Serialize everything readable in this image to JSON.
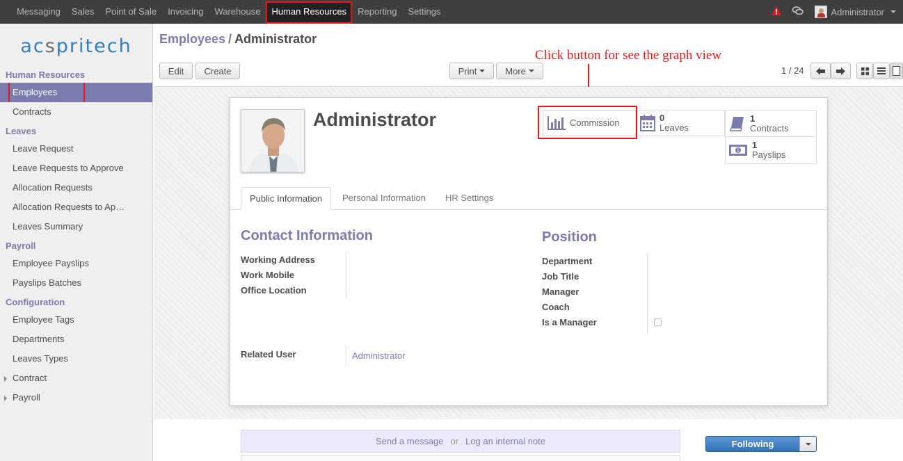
{
  "topbar": {
    "menu": [
      "Messaging",
      "Sales",
      "Point of Sale",
      "Invoicing",
      "Warehouse",
      "Human Resources",
      "Reporting",
      "Settings"
    ],
    "active_menu": "Human Resources",
    "user": "Administrator"
  },
  "sidebar": {
    "logo_left": "ac",
    "logo_mid": "s",
    "logo_right": "pritech",
    "sections": [
      {
        "title": "Human Resources",
        "items": [
          "Employees",
          "Contracts"
        ]
      },
      {
        "title": "Leaves",
        "items": [
          "Leave Request",
          "Leave Requests to Approve",
          "Allocation Requests",
          "Allocation Requests to Ap…",
          "Leaves Summary"
        ]
      },
      {
        "title": "Payroll",
        "items": [
          "Employee Payslips",
          "Payslips Batches"
        ]
      },
      {
        "title": "Configuration",
        "items": [
          "Employee Tags",
          "Departments",
          "Leaves Types"
        ]
      }
    ],
    "collapsed": [
      "Contract",
      "Payroll"
    ]
  },
  "control_panel": {
    "breadcrumb_parent": "Employees",
    "breadcrumb_sep": "/",
    "breadcrumb_current": "Administrator",
    "edit": "Edit",
    "create": "Create",
    "print": "Print",
    "more": "More",
    "pager": "1 / 24"
  },
  "annotation": "Click button for see the graph view",
  "employee": {
    "name": "Administrator",
    "smart_buttons": {
      "commission": "Commission",
      "leaves_count": "0",
      "leaves_label": "Leaves",
      "contracts_count": "1",
      "contracts_label": "Contracts",
      "payslips_count": "1",
      "payslips_label": "Payslips"
    },
    "tabs": [
      "Public Information",
      "Personal Information",
      "HR Settings"
    ],
    "contact_title": "Contact Information",
    "contact_labels": [
      "Working Address",
      "Work Mobile",
      "Office Location"
    ],
    "position_title": "Position",
    "position_labels": [
      "Department",
      "Job Title",
      "Manager",
      "Coach",
      "Is a Manager"
    ],
    "related_user_label": "Related User",
    "related_user_value": "Administrator"
  },
  "chatter": {
    "send_message": "Send a message",
    "or": "or",
    "log_note": "Log an internal note",
    "following": "Following"
  },
  "colors": {
    "accent": "#7c7bad",
    "annotation": "#e01b1b",
    "topbar": "#3f3f3f"
  }
}
